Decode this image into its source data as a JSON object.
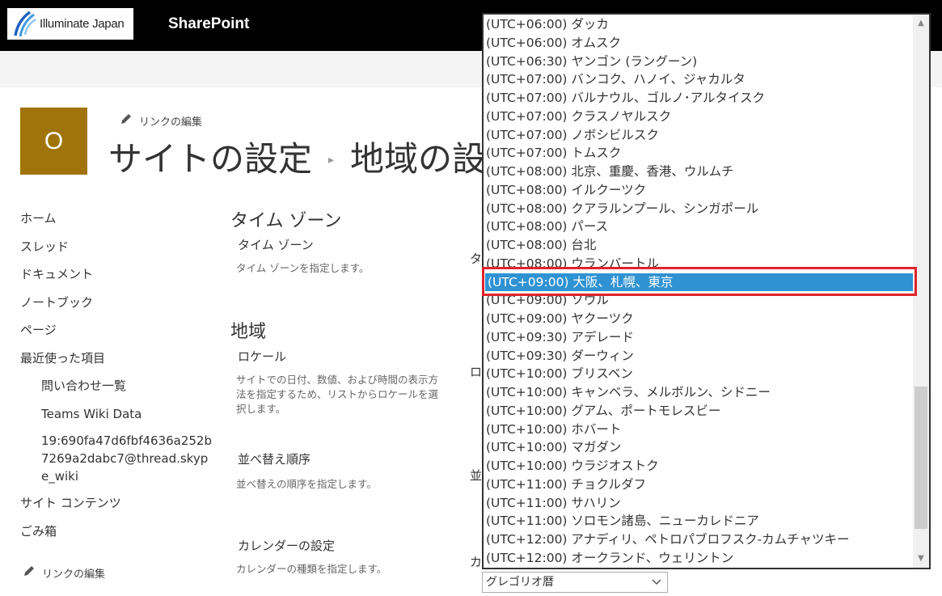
{
  "suitebar": {
    "logo_text": "Illuminate Japan",
    "app_name": "SharePoint"
  },
  "header": {
    "site_logo_letter": "O",
    "edit_links": "リンクの編集",
    "title": "サイトの設定",
    "title_sub": "地域の設"
  },
  "nav": {
    "items": [
      "ホーム",
      "スレッド",
      "ドキュメント",
      "ノートブック",
      "ページ",
      "最近使った項目"
    ],
    "recent": [
      "問い合わせ一覧",
      "Teams Wiki Data",
      "19:690fa47d6fbf4636a252b7269a2dabc7@thread.skype_wiki"
    ],
    "site_contents": "サイト コンテンツ",
    "recycle_bin": "ごみ箱",
    "edit_links": "リンクの編集"
  },
  "main": {
    "timezone_heading": "タイム ゾーン",
    "timezone_label": "タイム ゾーン",
    "timezone_desc": "タイム ゾーンを指定します。",
    "region_heading": "地域",
    "locale_label": "ロケール",
    "locale_desc": "サイトでの日付、数値、および時間の表示方法を指定するため、リストからロケールを選択します。",
    "sort_label": "並べ替え順序",
    "sort_desc": "並べ替えの順序を指定します。",
    "calendar_label": "カレンダーの設定",
    "calendar_desc": "カレンダーの種類を指定します。",
    "cut_labels": [
      "タ",
      "ロ",
      "並",
      "カ"
    ]
  },
  "dropdown": {
    "options": [
      "(UTC+06:00) ダッカ",
      "(UTC+06:00) オムスク",
      "(UTC+06:30) ヤンゴン (ラングーン)",
      "(UTC+07:00) バンコク、ハノイ、ジャカルタ",
      "(UTC+07:00) バルナウル、ゴルノ･アルタイスク",
      "(UTC+07:00) クラスノヤルスク",
      "(UTC+07:00) ノボシビルスク",
      "(UTC+07:00) トムスク",
      "(UTC+08:00) 北京、重慶、香港、ウルムチ",
      "(UTC+08:00) イルクーツク",
      "(UTC+08:00) クアラルンプール、シンガポール",
      "(UTC+08:00) パース",
      "(UTC+08:00) 台北",
      "(UTC+08:00) ウランバートル",
      "(UTC+09:00) 大阪、札幌、東京",
      "(UTC+09:00) ソウル",
      "(UTC+09:00) ヤクーツク",
      "(UTC+09:30) アデレード",
      "(UTC+09:30) ダーウィン",
      "(UTC+10:00) ブリスベン",
      "(UTC+10:00) キャンベラ、メルボルン、シドニー",
      "(UTC+10:00) グアム、ポートモレスビー",
      "(UTC+10:00) ホバート",
      "(UTC+10:00) マガダン",
      "(UTC+10:00) ウラジオストク",
      "(UTC+11:00) チョクルダフ",
      "(UTC+11:00) サハリン",
      "(UTC+11:00) ソロモン諸島、ニューカレドニア",
      "(UTC+12:00) アナディリ、ペトロパブロフスク-カムチャツキー",
      "(UTC+12:00) オークランド、ウェリントン"
    ],
    "selected_index": 14,
    "selection_color": "#2f92d3",
    "highlight_color": "#e0232b"
  },
  "calendar_select": {
    "value": "グレゴリオ暦"
  }
}
